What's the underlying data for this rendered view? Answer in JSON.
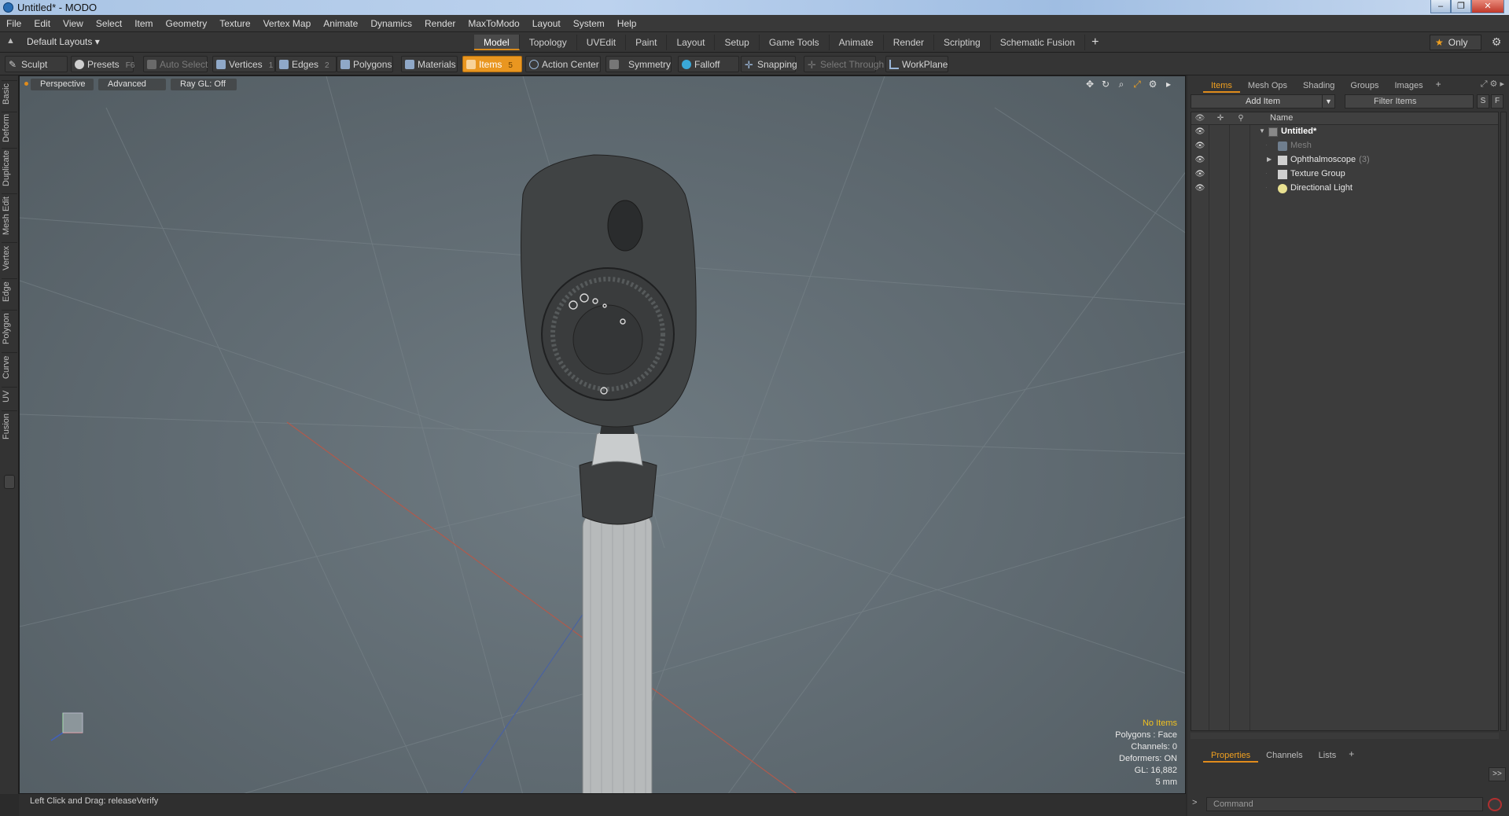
{
  "window": {
    "title": "Untitled* - MODO"
  },
  "menu": [
    "File",
    "Edit",
    "View",
    "Select",
    "Item",
    "Geometry",
    "Texture",
    "Vertex Map",
    "Animate",
    "Dynamics",
    "Render",
    "MaxToModo",
    "Layout",
    "System",
    "Help"
  ],
  "layout": {
    "selector": "Default Layouts ▾",
    "tabs": [
      "Model",
      "Topology",
      "UVEdit",
      "Paint",
      "Layout",
      "Setup",
      "Game Tools",
      "Animate",
      "Render",
      "Scripting",
      "Schematic Fusion"
    ],
    "active_tab": "Model",
    "only_label": "Only"
  },
  "toolbar": {
    "sculpt": "Sculpt",
    "presets": "Presets",
    "presets_key": "F6",
    "auto_select": "Auto Select",
    "vertices": "Vertices",
    "vertices_key": "1",
    "edges": "Edges",
    "edges_key": "2",
    "polygons": "Polygons",
    "materials": "Materials",
    "items": "Items",
    "items_key": "5",
    "action_center": "Action Center",
    "symmetry": "Symmetry",
    "falloff": "Falloff",
    "snapping": "Snapping",
    "select_through": "Select Through",
    "workplane": "WorkPlane"
  },
  "left_tabs": [
    "Basic",
    "Deform",
    "Duplicate",
    "Mesh Edit",
    "Vertex",
    "Edge",
    "Polygon",
    "Curve",
    "UV",
    "Fusion"
  ],
  "viewport": {
    "view": "Perspective",
    "mode": "Advanced",
    "raygl": "Ray GL: Off",
    "info": {
      "selection": "No Items",
      "polygons": "Polygons : Face",
      "channels": "Channels: 0",
      "deformers": "Deformers: ON",
      "gl": "GL: 16,882",
      "scale": "5 mm"
    }
  },
  "status": {
    "text": "Left Click and Drag:   releaseVerify"
  },
  "right_panel": {
    "tabs": [
      "Items",
      "Mesh Ops",
      "Shading",
      "Groups",
      "Images"
    ],
    "active_tab": "Items",
    "add_item": "Add Item",
    "filter_placeholder": "Filter Items",
    "s_btn": "S",
    "f_btn": "F",
    "name_header": "Name",
    "items": [
      {
        "label": "Untitled*",
        "level": 0,
        "expanded": true,
        "bold": true
      },
      {
        "label": "Mesh",
        "level": 1,
        "dim": true
      },
      {
        "label": "Ophthalmoscope",
        "count": "(3)",
        "level": 1,
        "collapsed": true
      },
      {
        "label": "Texture Group",
        "level": 1
      },
      {
        "label": "Directional Light",
        "level": 1
      }
    ],
    "bottom_tabs": [
      "Properties",
      "Channels",
      "Lists"
    ],
    "bottom_active": "Properties",
    "arrow_btn": ">>",
    "command_placeholder": "Command",
    "command_prompt": ">"
  },
  "colors": {
    "accent": "#e99620",
    "viewport_bg": "#626d74",
    "panel_bg": "#343434"
  }
}
